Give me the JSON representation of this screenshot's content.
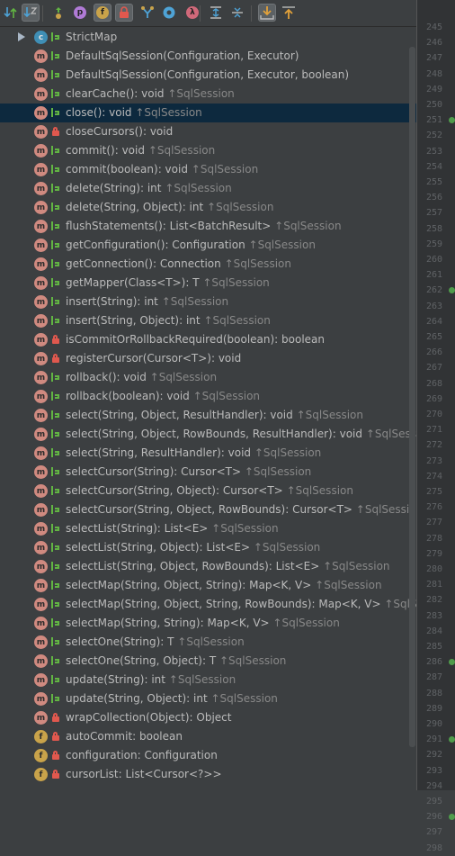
{
  "toolbar": {
    "buttons": [
      {
        "name": "sort-by-visibility-icon",
        "active": false
      },
      {
        "name": "sort-alphabetically-icon",
        "active": true
      },
      {
        "name": "show-inherited-icon",
        "active": false
      },
      {
        "name": "show-properties-icon",
        "active": false
      },
      {
        "name": "show-fields-icon",
        "active": true
      },
      {
        "name": "show-non-public-icon",
        "active": true
      },
      {
        "name": "show-anonymous-classes-icon",
        "active": false
      },
      {
        "name": "show-lambdas-icon",
        "active": false
      },
      {
        "name": "expand-all-icon",
        "active": false
      },
      {
        "name": "collapse-all-icon",
        "active": false
      },
      {
        "name": "autoscroll-to-source-icon",
        "active": true
      },
      {
        "name": "autoscroll-from-source-icon",
        "active": false
      }
    ],
    "glyphs": {
      "properties": "p",
      "fields": "f",
      "lambdas": "λ"
    }
  },
  "tree": {
    "items": [
      {
        "kind": "c",
        "vis": "pub",
        "sig": "StrictMap",
        "ovr": "",
        "expandable": true
      },
      {
        "kind": "m",
        "vis": "pub",
        "sig": "DefaultSqlSession(Configuration, Executor)",
        "ovr": ""
      },
      {
        "kind": "m",
        "vis": "pub",
        "sig": "DefaultSqlSession(Configuration, Executor, boolean)",
        "ovr": ""
      },
      {
        "kind": "m",
        "vis": "pub",
        "sig": "clearCache(): void",
        "ovr": "↑SqlSession"
      },
      {
        "kind": "m",
        "vis": "pub",
        "sig": "close(): void",
        "ovr": "↑SqlSession",
        "selected": true
      },
      {
        "kind": "m",
        "vis": "priv",
        "sig": "closeCursors(): void",
        "ovr": ""
      },
      {
        "kind": "m",
        "vis": "pub",
        "sig": "commit(): void",
        "ovr": "↑SqlSession"
      },
      {
        "kind": "m",
        "vis": "pub",
        "sig": "commit(boolean): void",
        "ovr": "↑SqlSession"
      },
      {
        "kind": "m",
        "vis": "pub",
        "sig": "delete(String): int",
        "ovr": "↑SqlSession"
      },
      {
        "kind": "m",
        "vis": "pub",
        "sig": "delete(String, Object): int",
        "ovr": "↑SqlSession"
      },
      {
        "kind": "m",
        "vis": "pub",
        "sig": "flushStatements(): List<BatchResult>",
        "ovr": "↑SqlSession"
      },
      {
        "kind": "m",
        "vis": "pub",
        "sig": "getConfiguration(): Configuration",
        "ovr": "↑SqlSession"
      },
      {
        "kind": "m",
        "vis": "pub",
        "sig": "getConnection(): Connection",
        "ovr": "↑SqlSession"
      },
      {
        "kind": "m",
        "vis": "pub",
        "sig": "getMapper(Class<T>): T",
        "ovr": "↑SqlSession"
      },
      {
        "kind": "m",
        "vis": "pub",
        "sig": "insert(String): int",
        "ovr": "↑SqlSession"
      },
      {
        "kind": "m",
        "vis": "pub",
        "sig": "insert(String, Object): int",
        "ovr": "↑SqlSession"
      },
      {
        "kind": "m",
        "vis": "priv",
        "sig": "isCommitOrRollbackRequired(boolean): boolean",
        "ovr": ""
      },
      {
        "kind": "m",
        "vis": "priv",
        "sig": "registerCursor(Cursor<T>): void",
        "ovr": ""
      },
      {
        "kind": "m",
        "vis": "pub",
        "sig": "rollback(): void",
        "ovr": "↑SqlSession"
      },
      {
        "kind": "m",
        "vis": "pub",
        "sig": "rollback(boolean): void",
        "ovr": "↑SqlSession"
      },
      {
        "kind": "m",
        "vis": "pub",
        "sig": "select(String, Object, ResultHandler): void",
        "ovr": "↑SqlSession"
      },
      {
        "kind": "m",
        "vis": "pub",
        "sig": "select(String, Object, RowBounds, ResultHandler): void",
        "ovr": "↑SqlSession"
      },
      {
        "kind": "m",
        "vis": "pub",
        "sig": "select(String, ResultHandler): void",
        "ovr": "↑SqlSession"
      },
      {
        "kind": "m",
        "vis": "pub",
        "sig": "selectCursor(String): Cursor<T>",
        "ovr": "↑SqlSession"
      },
      {
        "kind": "m",
        "vis": "pub",
        "sig": "selectCursor(String, Object): Cursor<T>",
        "ovr": "↑SqlSession"
      },
      {
        "kind": "m",
        "vis": "pub",
        "sig": "selectCursor(String, Object, RowBounds): Cursor<T>",
        "ovr": "↑SqlSession"
      },
      {
        "kind": "m",
        "vis": "pub",
        "sig": "selectList(String): List<E>",
        "ovr": "↑SqlSession"
      },
      {
        "kind": "m",
        "vis": "pub",
        "sig": "selectList(String, Object): List<E>",
        "ovr": "↑SqlSession"
      },
      {
        "kind": "m",
        "vis": "pub",
        "sig": "selectList(String, Object, RowBounds): List<E>",
        "ovr": "↑SqlSession"
      },
      {
        "kind": "m",
        "vis": "pub",
        "sig": "selectMap(String, Object, String): Map<K, V>",
        "ovr": "↑SqlSession"
      },
      {
        "kind": "m",
        "vis": "pub",
        "sig": "selectMap(String, Object, String, RowBounds): Map<K, V>",
        "ovr": "↑SqlSess"
      },
      {
        "kind": "m",
        "vis": "pub",
        "sig": "selectMap(String, String): Map<K, V>",
        "ovr": "↑SqlSession"
      },
      {
        "kind": "m",
        "vis": "pub",
        "sig": "selectOne(String): T",
        "ovr": "↑SqlSession"
      },
      {
        "kind": "m",
        "vis": "pub",
        "sig": "selectOne(String, Object): T",
        "ovr": "↑SqlSession"
      },
      {
        "kind": "m",
        "vis": "pub",
        "sig": "update(String): int",
        "ovr": "↑SqlSession"
      },
      {
        "kind": "m",
        "vis": "pub",
        "sig": "update(String, Object): int",
        "ovr": "↑SqlSession"
      },
      {
        "kind": "m",
        "vis": "priv",
        "sig": "wrapCollection(Object): Object",
        "ovr": ""
      },
      {
        "kind": "f",
        "vis": "priv",
        "sig": "autoCommit: boolean",
        "ovr": ""
      },
      {
        "kind": "f",
        "vis": "priv",
        "sig": "configuration: Configuration",
        "ovr": ""
      },
      {
        "kind": "f",
        "vis": "priv",
        "sig": "cursorList: List<Cursor<?>>",
        "ovr": ""
      }
    ],
    "kind_glyphs": {
      "m": "m",
      "f": "f",
      "c": "c"
    }
  },
  "gutter": {
    "line_numbers": [
      "245",
      "246",
      "247",
      "248",
      "249",
      "250",
      "251",
      "252",
      "253",
      "254",
      "255",
      "256",
      "257",
      "258",
      "259",
      "260",
      "261",
      "262",
      "263",
      "264",
      "265",
      "266",
      "267",
      "268",
      "269",
      "270",
      "271",
      "272",
      "273",
      "274",
      "275",
      "276",
      "277",
      "278",
      "279",
      "280",
      "281",
      "282",
      "283",
      "284",
      "285",
      "286",
      "287",
      "288",
      "289",
      "290",
      "291",
      "292",
      "293",
      "294",
      "295",
      "296",
      "297",
      "298"
    ],
    "marked_lines": [
      "251",
      "262",
      "286",
      "291",
      "296"
    ]
  }
}
